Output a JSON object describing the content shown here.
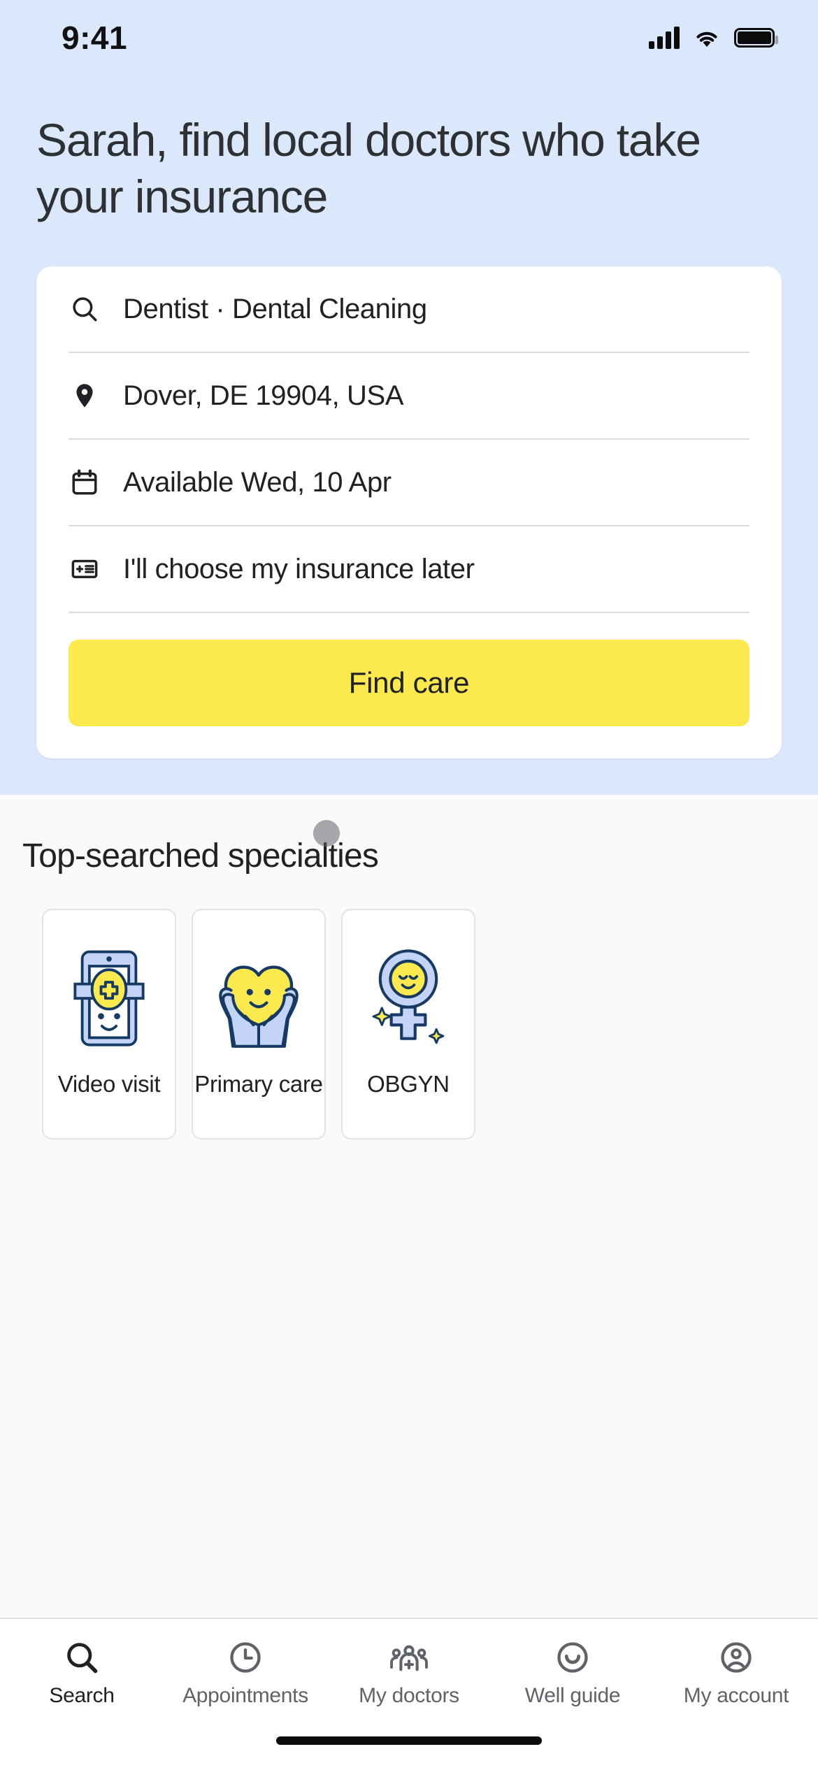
{
  "status_bar": {
    "time": "9:41",
    "icons": [
      "signal-bars-icon",
      "wifi-icon",
      "battery-icon"
    ]
  },
  "hero": {
    "headline": "Sarah, find local doctors who take your insurance",
    "background_color": "#DBE7FB"
  },
  "search_card": {
    "rows": [
      {
        "icon": "search-icon",
        "value": "Dentist · Dental Cleaning"
      },
      {
        "icon": "location-pin-icon",
        "value": "Dover, DE 19904, USA"
      },
      {
        "icon": "calendar-icon",
        "value": "Available Wed, 10 Apr"
      },
      {
        "icon": "insurance-card-icon",
        "value": "I'll choose my insurance later"
      }
    ],
    "submit_label": "Find care",
    "submit_color": "#FBE94E"
  },
  "specialties": {
    "title": "Top-searched specialties",
    "cards": [
      {
        "label": "Video visit",
        "art": "phone-with-medical-cross-illustration"
      },
      {
        "label": "Primary care",
        "art": "hands-holding-heart-illustration"
      },
      {
        "label": "OBGYN",
        "art": "female-symbol-face-illustration"
      }
    ]
  },
  "bottom_nav": {
    "items": [
      {
        "label": "Search",
        "icon": "search-icon",
        "active": true
      },
      {
        "label": "Appointments",
        "icon": "clock-icon",
        "active": false
      },
      {
        "label": "My doctors",
        "icon": "doctors-group-icon",
        "active": false
      },
      {
        "label": "Well guide",
        "icon": "smiley-face-icon",
        "active": false
      },
      {
        "label": "My account",
        "icon": "account-circle-icon",
        "active": false
      }
    ]
  }
}
